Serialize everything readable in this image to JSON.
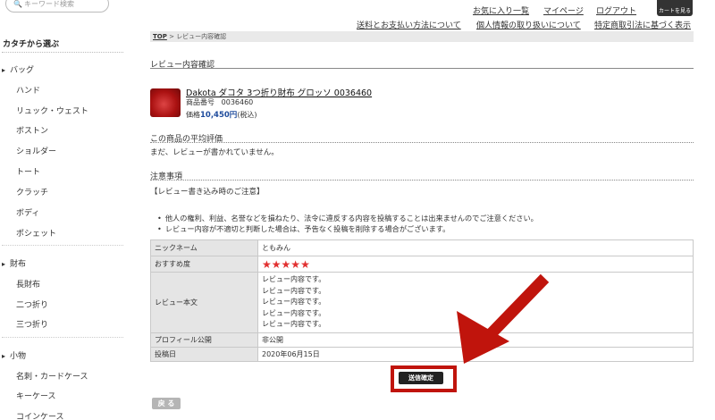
{
  "search": {
    "placeholder": "キーワード検索"
  },
  "sidebar": {
    "title": "カタチから選ぶ",
    "groups": [
      {
        "label": "バッグ",
        "items": [
          "ハンド",
          "リュック・ウェスト",
          "ボストン",
          "ショルダー",
          "トート",
          "クラッチ",
          "ボディ",
          "ポシェット"
        ]
      },
      {
        "label": "財布",
        "items": [
          "長財布",
          "二つ折り",
          "三つ折り"
        ]
      },
      {
        "label": "小物",
        "items": [
          "名刺・カードケース",
          "キーケース",
          "コインケース"
        ]
      }
    ]
  },
  "header": {
    "links": [
      "お気に入り一覧",
      "マイページ",
      "ログアウト"
    ],
    "cart_label": "カートを見る",
    "sublinks": [
      "送料とお支払い方法について",
      "個人情報の取り扱いについて",
      "特定商取引法に基づく表示"
    ]
  },
  "breadcrumb": {
    "top": "TOP",
    "sep": " > ",
    "current": "レビュー内容確認"
  },
  "page": {
    "heading": "レビュー内容確認",
    "product": {
      "name": "Dakota ダコタ 3つ折り財布 グロッソ 0036460",
      "code_label": "商品番号",
      "code": "0036460",
      "price_label": "価格",
      "price": "10,450円",
      "tax": "(税込)"
    },
    "avg_title": "この商品の平均評価",
    "avg_text": "まだ、レビューが書かれていません。",
    "notes_title": "注意事項",
    "notes_heading": "【レビュー書き込み時のご注意】",
    "notes": [
      "他人の権利、利益、名誉などを損ねたり、法令に違反する内容を投稿することは出来ませんのでご注意ください。",
      "レビュー内容が不適切と判断した場合は、予告なく投稿を削除する場合がございます。"
    ],
    "table": {
      "nickname_label": "ニックネーム",
      "nickname": "ともみん",
      "rating_label": "おすすめ度",
      "rating": 5,
      "rating_max": 5,
      "body_label": "レビュー本文",
      "body_lines": [
        "レビュー内容です。",
        "レビュー内容です。",
        "レビュー内容です。",
        "レビュー内容です。",
        "レビュー内容です。"
      ],
      "profile_label": "プロフィール公開",
      "profile": "非公開",
      "date_label": "投稿日",
      "date": "2020年06月15日"
    },
    "submit_label": "送信確定",
    "back_label": "戻 る"
  },
  "colors": {
    "accent_red": "#c0140c",
    "price_blue": "#1e4b9c",
    "star_red": "#e23030"
  }
}
